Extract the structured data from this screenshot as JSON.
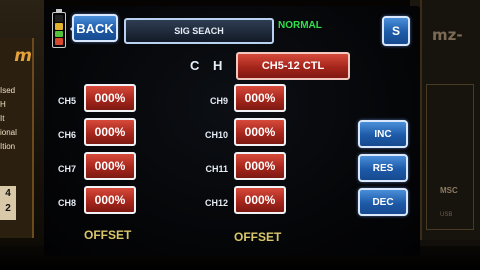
{
  "header": {
    "back_label": "BACK",
    "title": "SIG SEACH",
    "mode": "NORMAL",
    "menu_label": "S"
  },
  "battery": {
    "cell_colors": [
      "#1f1f1f",
      "#e2b12d",
      "#52c23a",
      "#d8482f"
    ]
  },
  "channel_heading": "C H",
  "ctl_button_label": "CH5-12 CTL",
  "left_channels": [
    {
      "label": "CH5",
      "value": "000%"
    },
    {
      "label": "CH6",
      "value": "000%"
    },
    {
      "label": "CH7",
      "value": "000%"
    },
    {
      "label": "CH8",
      "value": "000%"
    }
  ],
  "right_channels": [
    {
      "label": "CH9",
      "value": "000%"
    },
    {
      "label": "CH10",
      "value": "000%"
    },
    {
      "label": "CH11",
      "value": "000%"
    },
    {
      "label": "CH12",
      "value": "000%"
    }
  ],
  "side_buttons": [
    "INC",
    "RES",
    "DEC"
  ],
  "offset_labels": [
    "OFFSET",
    "OFFSET"
  ],
  "left_panel": {
    "brand": "m",
    "lines": [
      "Ised",
      "H",
      "It",
      "ional",
      "Ition"
    ],
    "box": [
      "4",
      "2"
    ]
  },
  "right_panel": {
    "brand": "mz-",
    "label": "MSC",
    "sub": "USB"
  },
  "colors": {
    "accent_blue": "#1d5aa8",
    "value_red": "#a8261c",
    "mode_green": "#2fe04a",
    "offset_gold": "#d9c66a"
  }
}
